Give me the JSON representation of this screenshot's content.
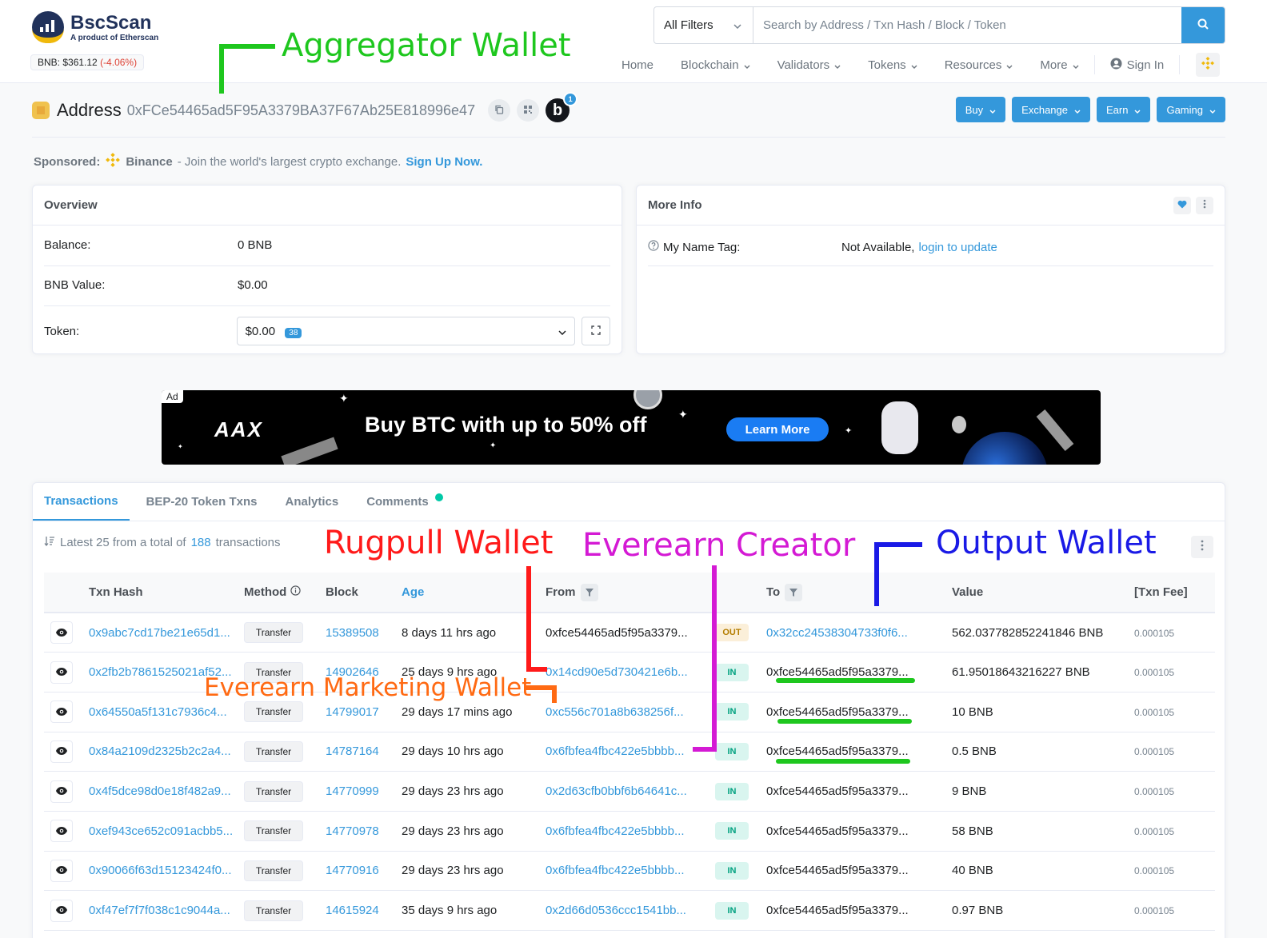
{
  "header": {
    "logo_title": "BscScan",
    "logo_sub": "A product of Etherscan",
    "price_label": "BNB: $361.12",
    "price_change": "(-4.06%)",
    "filter_label": "All Filters",
    "search_placeholder": "Search by Address / Txn Hash / Block / Token",
    "nav": [
      "Home",
      "Blockchain",
      "Validators",
      "Tokens",
      "Resources",
      "More"
    ],
    "sign_in": "Sign In"
  },
  "address": {
    "label": "Address",
    "hash": "0xFCe54465ad5F95A3379BA37F67Ab25E818996e47",
    "blockscan_letter": "b",
    "blockscan_badge": "1",
    "buttons": [
      "Buy",
      "Exchange",
      "Earn",
      "Gaming"
    ]
  },
  "sponsored": {
    "label": "Sponsored:",
    "brand": "Binance",
    "text": "- Join the world's largest crypto exchange.",
    "link": "Sign Up Now."
  },
  "overview": {
    "title": "Overview",
    "balance_label": "Balance:",
    "balance_value": "0 BNB",
    "value_label": "BNB Value:",
    "value_value": "$0.00",
    "token_label": "Token:",
    "token_value": "$0.00",
    "token_count": "38"
  },
  "more_info": {
    "title": "More Info",
    "name_tag_label": "My Name Tag:",
    "name_tag_value": "Not Available,",
    "name_tag_link": "login to update"
  },
  "ad": {
    "tag": "Ad",
    "logo": "AAX",
    "headline": "Buy BTC with up to 50% off",
    "cta": "Learn More"
  },
  "tabs": [
    "Transactions",
    "BEP-20 Token Txns",
    "Analytics",
    "Comments"
  ],
  "summary": {
    "prefix": "Latest 25 from a total of",
    "count": "188",
    "suffix": "transactions"
  },
  "columns": [
    "Txn Hash",
    "Method",
    "Block",
    "Age",
    "From",
    "To",
    "Value",
    "[Txn Fee]"
  ],
  "rows": [
    {
      "hash": "0x9abc7cd17be21e65d1...",
      "method": "Transfer",
      "block": "15389508",
      "age": "8 days 11 hrs ago",
      "from": "0xfce54465ad5f95a3379...",
      "dir": "OUT",
      "to": "0x32cc24538304733f0f6...",
      "value": "562.037782852241846 BNB",
      "fee": "0.000105"
    },
    {
      "hash": "0x2fb2b7861525021af52...",
      "method": "Transfer",
      "block": "14902646",
      "age": "25 days 9 hrs ago",
      "from": "0x14cd90e5d730421e6b...",
      "dir": "IN",
      "to": "0xfce54465ad5f95a3379...",
      "value": "61.95018643216227 BNB",
      "fee": "0.000105"
    },
    {
      "hash": "0x64550a5f131c7936c4...",
      "method": "Transfer",
      "block": "14799017",
      "age": "29 days 17 mins ago",
      "from": "0xc556c701a8b638256f...",
      "dir": "IN",
      "to": "0xfce54465ad5f95a3379...",
      "value": "10 BNB",
      "fee": "0.000105"
    },
    {
      "hash": "0x84a2109d2325b2c2a4...",
      "method": "Transfer",
      "block": "14787164",
      "age": "29 days 10 hrs ago",
      "from": "0x6fbfea4fbc422e5bbbb...",
      "dir": "IN",
      "to": "0xfce54465ad5f95a3379...",
      "value": "0.5 BNB",
      "fee": "0.000105"
    },
    {
      "hash": "0x4f5dce98d0e18f482a9...",
      "method": "Transfer",
      "block": "14770999",
      "age": "29 days 23 hrs ago",
      "from": "0x2d63cfb0bbf6b64641c...",
      "dir": "IN",
      "to": "0xfce54465ad5f95a3379...",
      "value": "9 BNB",
      "fee": "0.000105"
    },
    {
      "hash": "0xef943ce652c091acbb5...",
      "method": "Transfer",
      "block": "14770978",
      "age": "29 days 23 hrs ago",
      "from": "0x6fbfea4fbc422e5bbbb...",
      "dir": "IN",
      "to": "0xfce54465ad5f95a3379...",
      "value": "58 BNB",
      "fee": "0.000105"
    },
    {
      "hash": "0x90066f63d15123424f0...",
      "method": "Transfer",
      "block": "14770916",
      "age": "29 days 23 hrs ago",
      "from": "0x6fbfea4fbc422e5bbbb...",
      "dir": "IN",
      "to": "0xfce54465ad5f95a3379...",
      "value": "40 BNB",
      "fee": "0.000105"
    },
    {
      "hash": "0xf47ef7f7f038c1c9044a...",
      "method": "Transfer",
      "block": "14615924",
      "age": "35 days 9 hrs ago",
      "from": "0x2d66d0536ccc1541bb...",
      "dir": "IN",
      "to": "0xfce54465ad5f95a3379...",
      "value": "0.97 BNB",
      "fee": "0.000105"
    }
  ],
  "annotations": {
    "aggregator": "Aggregator Wallet",
    "rugpull": "Rugpull Wallet",
    "creator": "Everearn Creator",
    "output": "Output Wallet",
    "marketing": "Everearn Marketing Wallet"
  },
  "colors": {
    "accent": "#3498db",
    "in_badge": "#00a17f",
    "out_badge": "#b47d00",
    "annotation_green": "#1ec71e",
    "annotation_red": "#ff1a1a",
    "annotation_purple": "#d41ad4",
    "annotation_blue": "#1a1ae6",
    "annotation_orange": "#ff6a13"
  }
}
